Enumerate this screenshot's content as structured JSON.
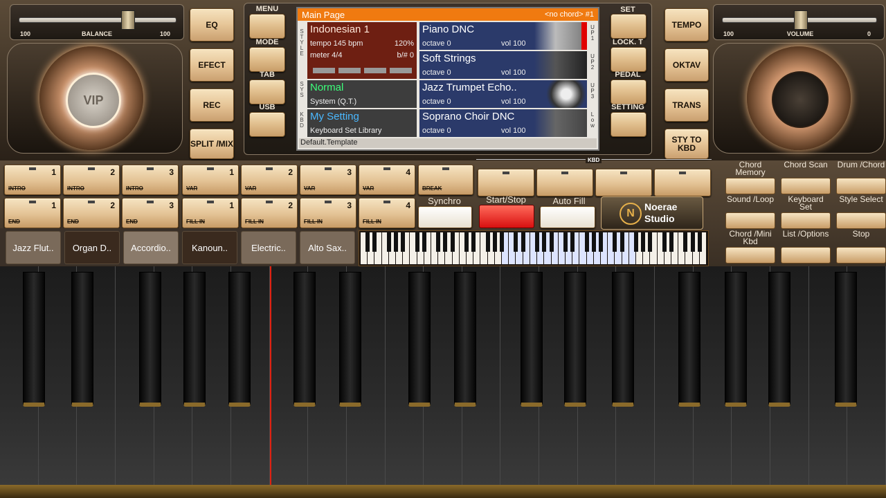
{
  "left": {
    "balance": {
      "label": "BALANCE",
      "min_label": "100",
      "max_label": "100"
    },
    "dial_label": "VIP",
    "buttons": [
      {
        "label": "EQ"
      },
      {
        "label": "EFECT"
      },
      {
        "label": "REC"
      },
      {
        "label": "SPLIT /MIX"
      }
    ]
  },
  "menu_column": [
    {
      "label": "MENU"
    },
    {
      "label": "MODE"
    },
    {
      "label": "TAB"
    },
    {
      "label": "USB"
    }
  ],
  "lcd": {
    "header_title": "Main Page",
    "header_right": "<no chord> #1",
    "side_tags": [
      "STYLE",
      "SYS",
      "KBD"
    ],
    "right_tags": [
      "UP1",
      "UP2",
      "UP3",
      "Low"
    ],
    "style": {
      "name": "Indonesian 1",
      "tempo": "tempo 145 bpm",
      "percent": "120%",
      "meter": "meter 4/4",
      "key": "b/# 0"
    },
    "system": {
      "name": "Normal",
      "sub": "System (Q.T.)"
    },
    "kbd": {
      "name": "My Setting",
      "sub": "Keyboard Set Library"
    },
    "voices": [
      {
        "name": "Piano DNC",
        "octave": "octave 0",
        "vol": "vol 100"
      },
      {
        "name": "Soft Strings",
        "octave": "octave 0",
        "vol": "vol 100"
      },
      {
        "name": "Jazz Trumpet Echo..",
        "octave": "octave 0",
        "vol": "vol 100"
      },
      {
        "name": "Soprano Choir DNC",
        "octave": "octave 0",
        "vol": "vol 100"
      }
    ],
    "footer": "Default.Template"
  },
  "set_column": [
    {
      "label": "SET"
    },
    {
      "label": "LOCK. T"
    },
    {
      "label": "PEDAL"
    },
    {
      "label": "SETTING"
    }
  ],
  "right": {
    "volume": {
      "label": "VOLUME",
      "min_label": "100",
      "max_label": "0"
    },
    "buttons": [
      {
        "label": "TEMPO"
      },
      {
        "label": "OKTAV"
      },
      {
        "label": "TRANS"
      },
      {
        "label": "STY TO KBD"
      }
    ]
  },
  "pads_top": [
    {
      "num": "1",
      "name": "INTRO"
    },
    {
      "num": "2",
      "name": "INTRO"
    },
    {
      "num": "3",
      "name": "INTRO"
    },
    {
      "num": "1",
      "name": "VAR"
    },
    {
      "num": "2",
      "name": "VAR"
    },
    {
      "num": "3",
      "name": "VAR"
    },
    {
      "num": "4",
      "name": "VAR"
    },
    {
      "num": "",
      "name": "BREAK"
    }
  ],
  "pads_bottom": [
    {
      "num": "1",
      "name": "END"
    },
    {
      "num": "2",
      "name": "END"
    },
    {
      "num": "3",
      "name": "END"
    },
    {
      "num": "1",
      "name": "FILL IN"
    },
    {
      "num": "2",
      "name": "FILL IN"
    },
    {
      "num": "3",
      "name": "FILL IN"
    },
    {
      "num": "4",
      "name": "FILL IN"
    }
  ],
  "kbd_tag": "KBD",
  "transport": {
    "synchro": "Synchro",
    "start_stop": "Start/Stop",
    "auto_fill": "Auto Fill"
  },
  "logo": {
    "line1": "Noerae",
    "line2": "Studio"
  },
  "chord_buttons": [
    {
      "label": "Chord Memory"
    },
    {
      "label": "Chord Scan"
    },
    {
      "label": "Drum /Chord"
    },
    {
      "label": "Sound /Loop"
    },
    {
      "label": "Keyboard Set"
    },
    {
      "label": "Style Select"
    },
    {
      "label": "Chord /Mini Kbd"
    },
    {
      "label": "List /Options"
    },
    {
      "label": "Stop"
    }
  ],
  "voice_bank": [
    {
      "label": "Jazz Flut.."
    },
    {
      "label": "Organ D.."
    },
    {
      "label": "Accordio.."
    },
    {
      "label": "Kanoun.."
    },
    {
      "label": "Electric.."
    },
    {
      "label": "Alto Sax.."
    }
  ]
}
